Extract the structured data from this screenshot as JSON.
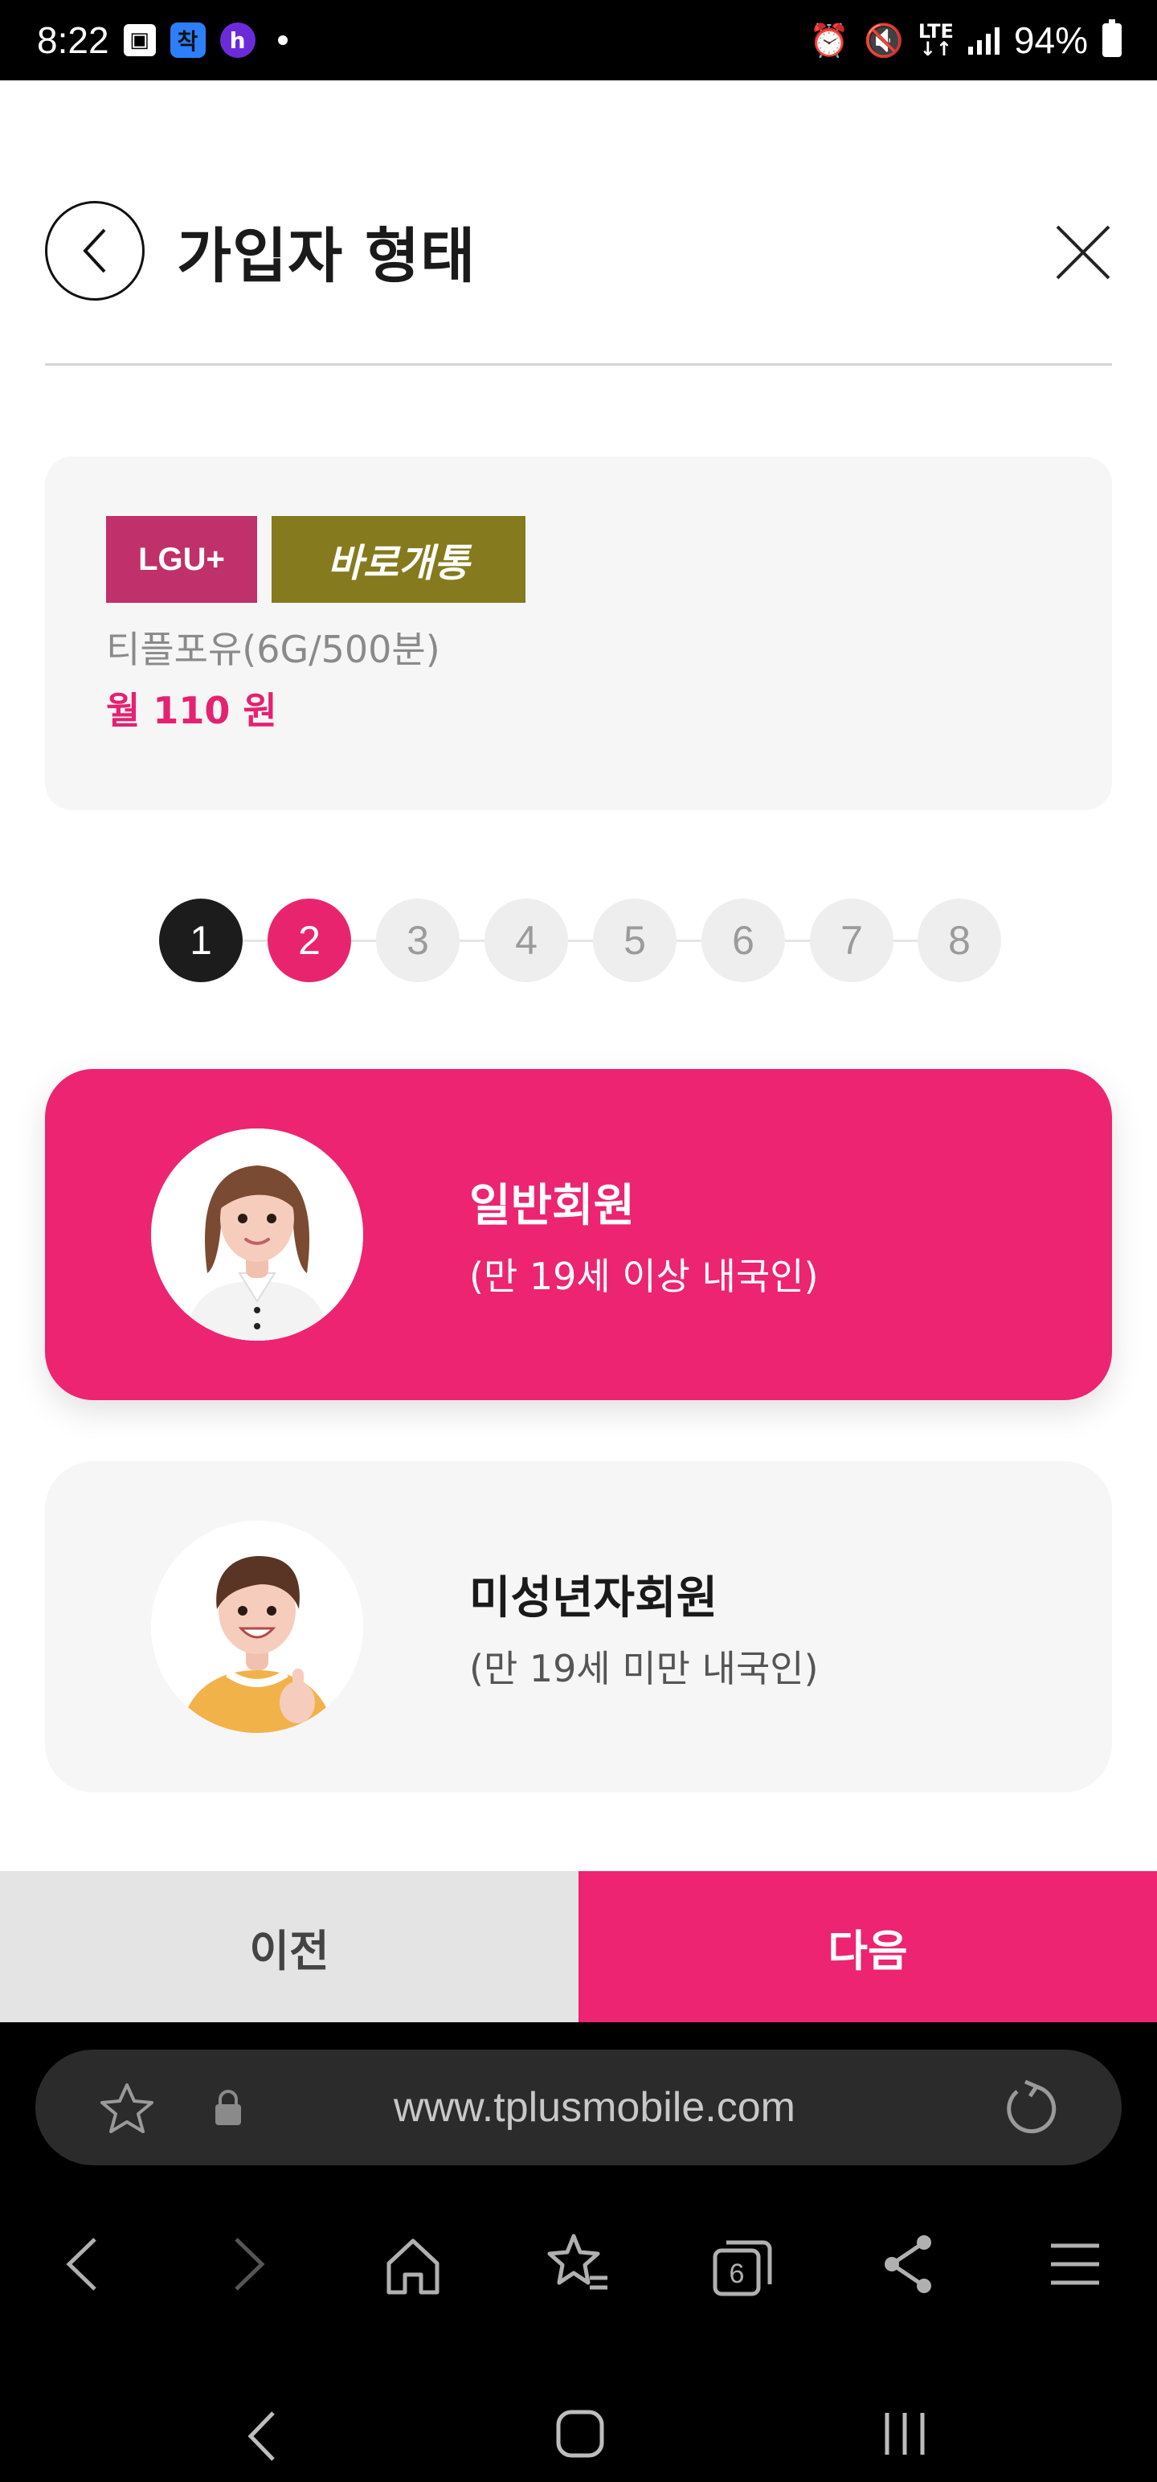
{
  "status_bar": {
    "time": "8:22",
    "app_icon_1": "착",
    "app_icon_2": "h",
    "network": "LTE",
    "battery": "94%"
  },
  "header": {
    "title": "가입자 형태",
    "back_icon": "chevron-left-icon",
    "close_icon": "close-icon"
  },
  "plan": {
    "carrier_badge": "LGU+",
    "instant_badge": "바로개통",
    "name": "티플포유(6G/500분)",
    "price": "월 110 원"
  },
  "stepper": {
    "steps": [
      "1",
      "2",
      "3",
      "4",
      "5",
      "6",
      "7",
      "8"
    ],
    "completed": 1,
    "current": 2
  },
  "member_types": [
    {
      "title": "일반회원",
      "subtitle": "(만 19세 이상 내국인)",
      "selected": true
    },
    {
      "title": "미성년자회원",
      "subtitle": "(만 19세 미만 내국인)",
      "selected": false
    }
  ],
  "actions": {
    "prev_label": "이전",
    "next_label": "다음"
  },
  "browser": {
    "url": "www.tplusmobile.com",
    "tab_count": "6"
  },
  "colors": {
    "accent": "#ec2472",
    "carrier_badge": "#c0306a",
    "instant_badge": "#857a1e",
    "step_done": "#1c1c1c"
  }
}
